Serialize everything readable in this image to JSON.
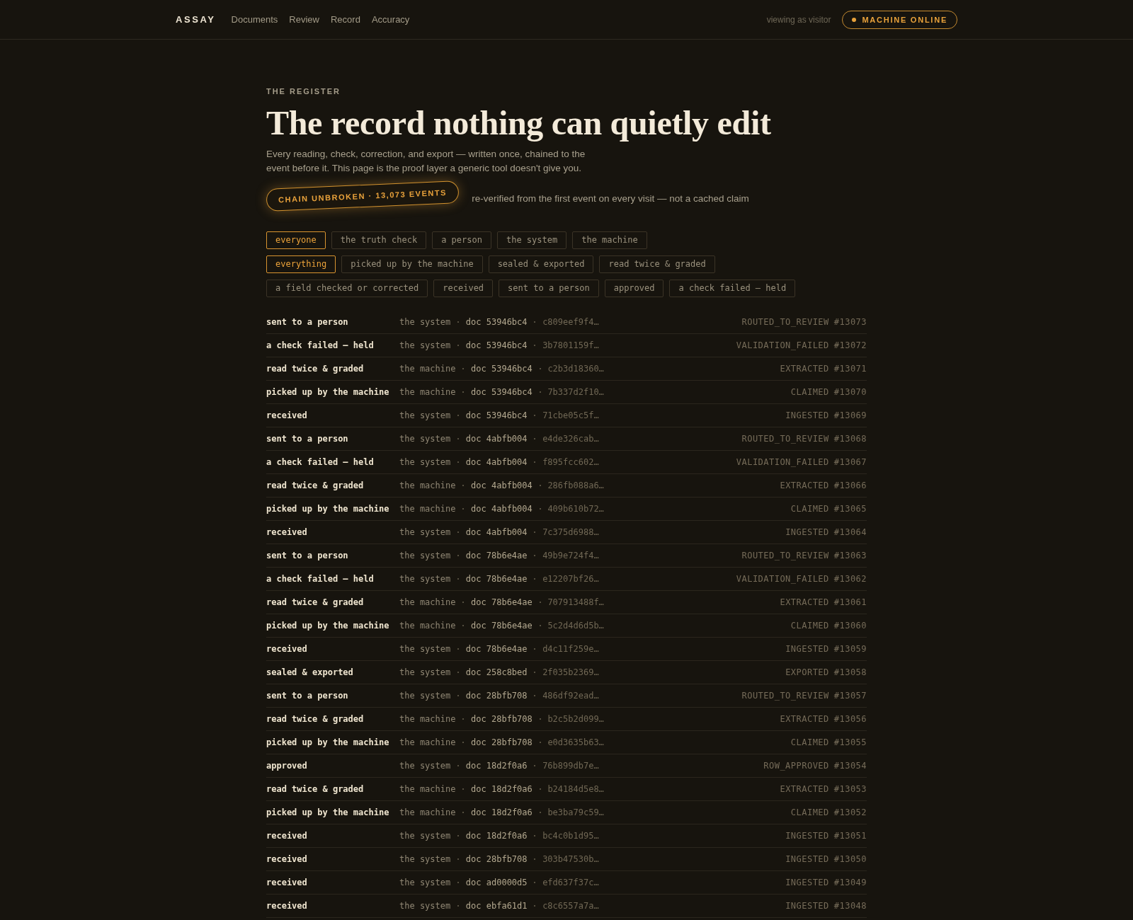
{
  "nav": {
    "brand": "ASSAY",
    "links": [
      {
        "label": "Documents",
        "selected": false
      },
      {
        "label": "Review",
        "selected": false
      },
      {
        "label": "Record",
        "selected": false
      },
      {
        "label": "Accuracy",
        "selected": false
      }
    ],
    "viewer_note": "viewing as visitor",
    "status": {
      "label": "MACHINE ONLINE",
      "online": true
    }
  },
  "hero": {
    "eyebrow": "THE REGISTER",
    "title": "The record nothing can quietly edit",
    "lede": "Every reading, check, correction, and export — written once, chained to the event before it. This page is the proof layer a generic tool doesn't give you.",
    "chain": {
      "badge": "CHAIN UNBROKEN · 13,073 EVENTS",
      "note": "re-verified from the first event on every visit — not a cached claim"
    }
  },
  "actor_filters": [
    {
      "label": "everyone",
      "selected": true
    },
    {
      "label": "the truth check",
      "selected": false
    },
    {
      "label": "a person",
      "selected": false
    },
    {
      "label": "the system",
      "selected": false
    },
    {
      "label": "the machine",
      "selected": false
    }
  ],
  "event_filters": [
    {
      "label": "everything",
      "selected": true
    },
    {
      "label": "picked up by the machine",
      "selected": false
    },
    {
      "label": "sealed & exported",
      "selected": false
    },
    {
      "label": "read twice & graded",
      "selected": false
    },
    {
      "label": "a field checked or corrected",
      "selected": false
    },
    {
      "label": "received",
      "selected": false
    },
    {
      "label": "sent to a person",
      "selected": false
    },
    {
      "label": "approved",
      "selected": false
    },
    {
      "label": "a check failed — held",
      "selected": false
    }
  ],
  "events": [
    {
      "label": "sent to a person",
      "actor": "the system",
      "doc": "doc 53946bc4",
      "hash": "c809eef9f4…",
      "code": "ROUTED_TO_REVIEW",
      "seq": "#13073"
    },
    {
      "label": "a check failed — held",
      "actor": "the system",
      "doc": "doc 53946bc4",
      "hash": "3b7801159f…",
      "code": "VALIDATION_FAILED",
      "seq": "#13072"
    },
    {
      "label": "read twice & graded",
      "actor": "the machine",
      "doc": "doc 53946bc4",
      "hash": "c2b3d18360…",
      "code": "EXTRACTED",
      "seq": "#13071"
    },
    {
      "label": "picked up by the machine",
      "actor": "the machine",
      "doc": "doc 53946bc4",
      "hash": "7b337d2f10…",
      "code": "CLAIMED",
      "seq": "#13070"
    },
    {
      "label": "received",
      "actor": "the system",
      "doc": "doc 53946bc4",
      "hash": "71cbe05c5f…",
      "code": "INGESTED",
      "seq": "#13069"
    },
    {
      "label": "sent to a person",
      "actor": "the system",
      "doc": "doc 4abfb004",
      "hash": "e4de326cab…",
      "code": "ROUTED_TO_REVIEW",
      "seq": "#13068"
    },
    {
      "label": "a check failed — held",
      "actor": "the system",
      "doc": "doc 4abfb004",
      "hash": "f895fcc602…",
      "code": "VALIDATION_FAILED",
      "seq": "#13067"
    },
    {
      "label": "read twice & graded",
      "actor": "the machine",
      "doc": "doc 4abfb004",
      "hash": "286fb088a6…",
      "code": "EXTRACTED",
      "seq": "#13066"
    },
    {
      "label": "picked up by the machine",
      "actor": "the machine",
      "doc": "doc 4abfb004",
      "hash": "409b610b72…",
      "code": "CLAIMED",
      "seq": "#13065"
    },
    {
      "label": "received",
      "actor": "the system",
      "doc": "doc 4abfb004",
      "hash": "7c375d6988…",
      "code": "INGESTED",
      "seq": "#13064"
    },
    {
      "label": "sent to a person",
      "actor": "the system",
      "doc": "doc 78b6e4ae",
      "hash": "49b9e724f4…",
      "code": "ROUTED_TO_REVIEW",
      "seq": "#13063"
    },
    {
      "label": "a check failed — held",
      "actor": "the system",
      "doc": "doc 78b6e4ae",
      "hash": "e12207bf26…",
      "code": "VALIDATION_FAILED",
      "seq": "#13062"
    },
    {
      "label": "read twice & graded",
      "actor": "the machine",
      "doc": "doc 78b6e4ae",
      "hash": "707913488f…",
      "code": "EXTRACTED",
      "seq": "#13061"
    },
    {
      "label": "picked up by the machine",
      "actor": "the machine",
      "doc": "doc 78b6e4ae",
      "hash": "5c2d4d6d5b…",
      "code": "CLAIMED",
      "seq": "#13060"
    },
    {
      "label": "received",
      "actor": "the system",
      "doc": "doc 78b6e4ae",
      "hash": "d4c11f259e…",
      "code": "INGESTED",
      "seq": "#13059"
    },
    {
      "label": "sealed & exported",
      "actor": "the system",
      "doc": "doc 258c8bed",
      "hash": "2f035b2369…",
      "code": "EXPORTED",
      "seq": "#13058"
    },
    {
      "label": "sent to a person",
      "actor": "the system",
      "doc": "doc 28bfb708",
      "hash": "486df92ead…",
      "code": "ROUTED_TO_REVIEW",
      "seq": "#13057"
    },
    {
      "label": "read twice & graded",
      "actor": "the machine",
      "doc": "doc 28bfb708",
      "hash": "b2c5b2d099…",
      "code": "EXTRACTED",
      "seq": "#13056"
    },
    {
      "label": "picked up by the machine",
      "actor": "the machine",
      "doc": "doc 28bfb708",
      "hash": "e0d3635b63…",
      "code": "CLAIMED",
      "seq": "#13055"
    },
    {
      "label": "approved",
      "actor": "the system",
      "doc": "doc 18d2f0a6",
      "hash": "76b899db7e…",
      "code": "ROW_APPROVED",
      "seq": "#13054"
    },
    {
      "label": "read twice & graded",
      "actor": "the machine",
      "doc": "doc 18d2f0a6",
      "hash": "b24184d5e8…",
      "code": "EXTRACTED",
      "seq": "#13053"
    },
    {
      "label": "picked up by the machine",
      "actor": "the machine",
      "doc": "doc 18d2f0a6",
      "hash": "be3ba79c59…",
      "code": "CLAIMED",
      "seq": "#13052"
    },
    {
      "label": "received",
      "actor": "the system",
      "doc": "doc 18d2f0a6",
      "hash": "bc4c0b1d95…",
      "code": "INGESTED",
      "seq": "#13051"
    },
    {
      "label": "received",
      "actor": "the system",
      "doc": "doc 28bfb708",
      "hash": "303b47530b…",
      "code": "INGESTED",
      "seq": "#13050"
    },
    {
      "label": "received",
      "actor": "the system",
      "doc": "doc ad0000d5",
      "hash": "efd637f37c…",
      "code": "INGESTED",
      "seq": "#13049"
    },
    {
      "label": "received",
      "actor": "the system",
      "doc": "doc ebfa61d1",
      "hash": "c8c6557a7a…",
      "code": "INGESTED",
      "seq": "#13048"
    }
  ]
}
